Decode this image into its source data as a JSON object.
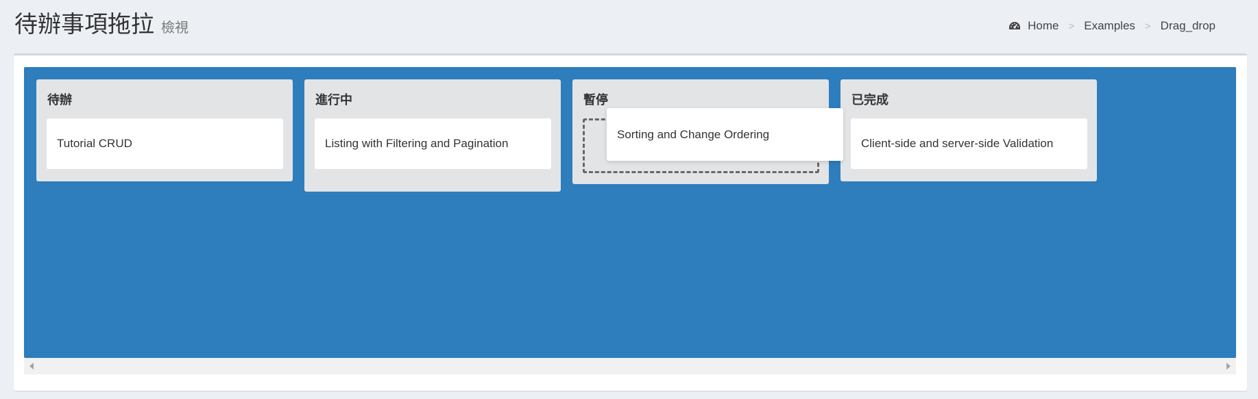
{
  "header": {
    "title": "待辦事項拖拉",
    "subtitle": "檢視"
  },
  "breadcrumb": {
    "icon": "dashboard-icon",
    "items": [
      "Home",
      "Examples",
      "Drag_drop"
    ],
    "separator": ">"
  },
  "colors": {
    "page_background": "#ecf0f5",
    "board_background": "#2e7dbc",
    "column_background": "#e3e4e6",
    "card_background": "#ffffff"
  },
  "board": {
    "columns": [
      {
        "title": "待辦",
        "cards": [
          "Tutorial CRUD"
        ]
      },
      {
        "title": "進行中",
        "cards": [
          "Listing with Filtering and Pagination"
        ]
      },
      {
        "title": "暫停",
        "cards": []
      },
      {
        "title": "已完成",
        "cards": [
          "Client-side and server-side Validation"
        ]
      }
    ],
    "dragging_card": "Sorting and Change Ordering"
  }
}
